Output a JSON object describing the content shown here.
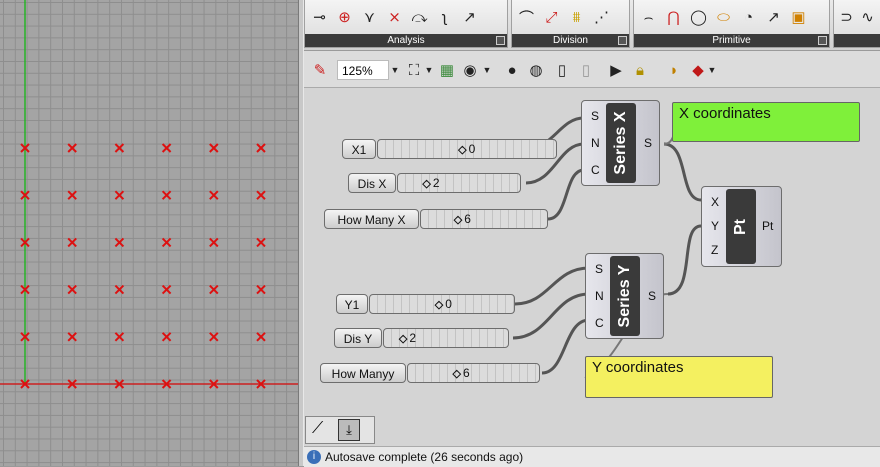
{
  "viewport": {
    "point_cols": 6,
    "point_rows": 6
  },
  "ribbon": {
    "panels": [
      {
        "label": "Analysis",
        "icons": [
          "circle-point-icon",
          "circle-arrow-icon",
          "branch-icon",
          "tangent-icon",
          "evaluate-icon",
          "curve-closest-icon",
          "end-points-icon"
        ]
      },
      {
        "label": "Division",
        "icons": [
          "divide-curve-icon",
          "divide-length-icon",
          "contour-icon",
          "shatter-icon"
        ]
      },
      {
        "label": "Primitive",
        "icons": [
          "arc-icon",
          "arc-3pt-icon",
          "circle-icon",
          "ellipse-icon",
          "fit-line-icon",
          "line-icon",
          "rectangle-icon"
        ]
      },
      {
        "label": "",
        "icons": [
          "nurbs-icon",
          "interp-icon"
        ]
      }
    ]
  },
  "toolbar": {
    "zoom": "125%"
  },
  "sliders": [
    {
      "label": "X1",
      "value": "0"
    },
    {
      "label": "Dis X",
      "value": "2"
    },
    {
      "label": "How Many X",
      "value": "6"
    },
    {
      "label": "Y1",
      "value": "0"
    },
    {
      "label": "Dis Y",
      "value": "2"
    },
    {
      "label": "How Manyy",
      "value": "6"
    }
  ],
  "components": {
    "series_x": {
      "title": "Series X",
      "inputs": [
        "S",
        "N",
        "C"
      ],
      "output": "S"
    },
    "series_y": {
      "title": "Series Y",
      "inputs": [
        "S",
        "N",
        "C"
      ],
      "output": "S"
    },
    "pt": {
      "title": "Pt",
      "inputs": [
        "X",
        "Y",
        "Z"
      ],
      "output": "Pt"
    }
  },
  "panels": {
    "x_note": {
      "text": "X coordinates",
      "color": "#7ff03a"
    },
    "y_note": {
      "text": "Y coordinates",
      "color": "#f4f060"
    }
  },
  "status": {
    "text": "Autosave complete (26 seconds ago)"
  }
}
